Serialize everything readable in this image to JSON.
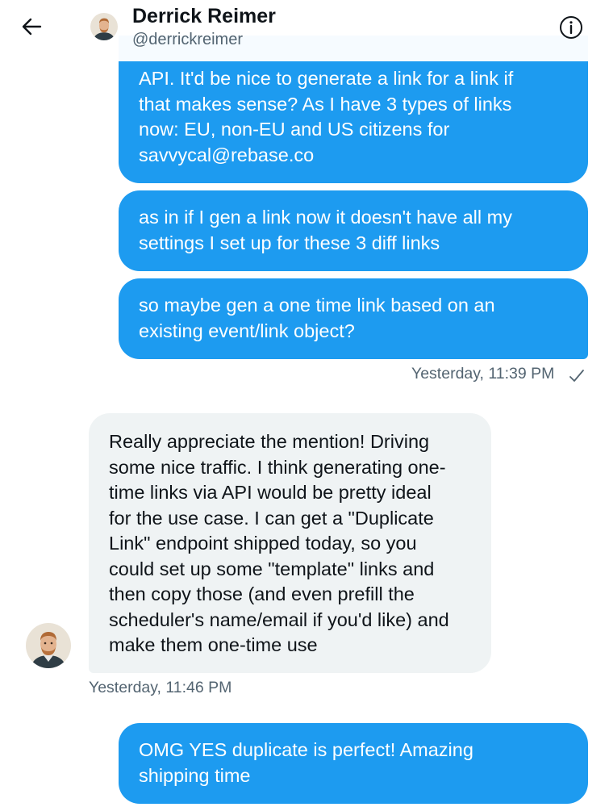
{
  "header": {
    "name": "Derrick Reimer",
    "handle": "@derrickreimer"
  },
  "messages": [
    {
      "direction": "outgoing",
      "lines": [
        "API. It'd be nice to generate a link for a link if",
        "that makes sense? As I have 3 types of links",
        "now: EU, non-EU and US citizens for",
        "savvycal@rebase.co"
      ]
    },
    {
      "direction": "outgoing",
      "lines": [
        "as in if I gen a link now it doesn't have all my",
        "settings I set up for these 3 diff links"
      ]
    },
    {
      "direction": "outgoing",
      "lines": [
        "so maybe gen a one time link based on an",
        "existing event/link object?"
      ],
      "timestamp": "Yesterday, 11:39 PM",
      "status_icon": "checkmark-icon"
    },
    {
      "direction": "incoming",
      "lines": [
        "Really appreciate the mention! Driving",
        "some nice traffic. I think generating one-",
        "time links via API would be pretty ideal",
        "for the use case. I can get a \"Duplicate",
        "Link\" endpoint shipped today, so you",
        "could set up some \"template\" links and",
        "then copy those (and even prefill the",
        "scheduler's name/email if you'd like) and",
        "make them one-time use"
      ],
      "timestamp": "Yesterday, 11:46 PM"
    },
    {
      "direction": "outgoing",
      "lines": [
        "OMG YES duplicate is perfect! Amazing",
        "shipping time"
      ]
    }
  ],
  "icons": {
    "back": "back-arrow-icon",
    "info": "info-icon"
  },
  "colors": {
    "outgoing_bubble": "#1d9bf0",
    "incoming_bubble": "#eff3f4",
    "secondary_text": "#536471"
  }
}
